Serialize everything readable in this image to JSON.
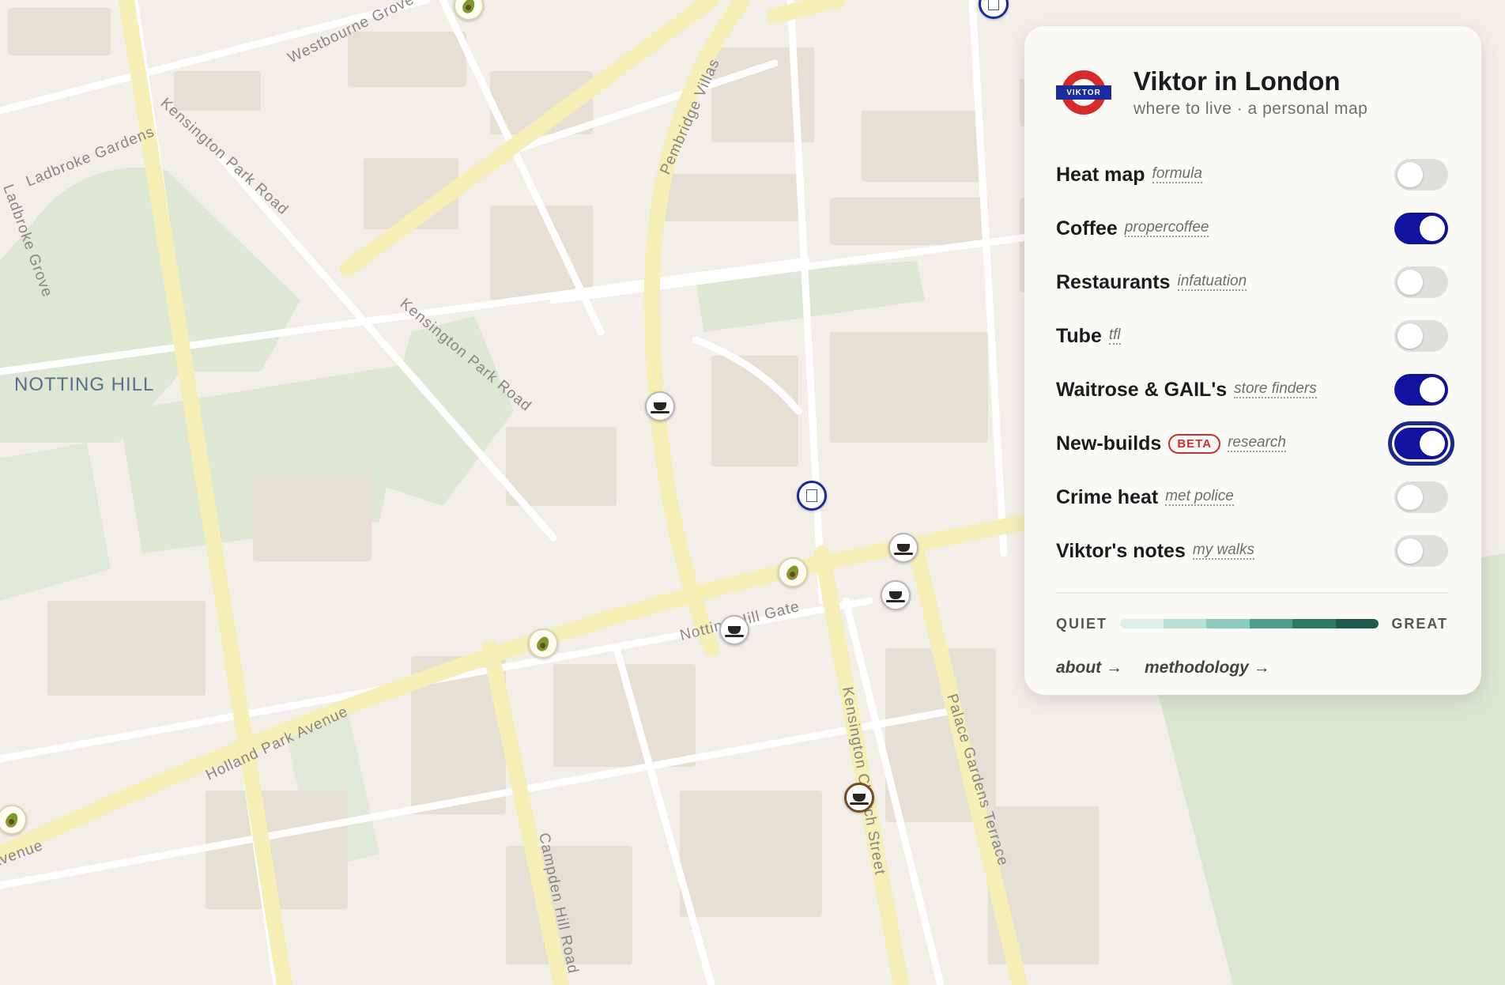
{
  "map": {
    "area_label": "NOTTING HILL",
    "streets": [
      "Westbourne Grove",
      "Ladbroke Gardens",
      "Kensington Park Road",
      "Kensington Park Road",
      "Pembridge Villas",
      "Notting Hill Gate",
      "Holland Park Avenue",
      "Campden Hill Road",
      "Kensington Church Street",
      "Palace Gardens Terrace",
      "Ladbroke Grove",
      "Avenue"
    ],
    "markers": [
      {
        "kind": "waitrose",
        "icon": "avocado-icon"
      },
      {
        "kind": "newbuild",
        "icon": "building-icon"
      },
      {
        "kind": "coffee",
        "icon": "coffee-cup-icon"
      },
      {
        "kind": "newbuild",
        "icon": "building-icon"
      },
      {
        "kind": "coffee",
        "icon": "coffee-cup-icon"
      },
      {
        "kind": "waitrose",
        "icon": "avocado-icon"
      },
      {
        "kind": "coffee",
        "icon": "coffee-cup-icon"
      },
      {
        "kind": "coffee",
        "icon": "coffee-cup-icon"
      },
      {
        "kind": "waitrose",
        "icon": "avocado-icon"
      },
      {
        "kind": "coffee",
        "icon": "coffee-cup-icon",
        "favourite": true
      },
      {
        "kind": "waitrose",
        "icon": "avocado-icon"
      }
    ]
  },
  "panel": {
    "roundel_text": "VIKTOR",
    "title": "Viktor in London",
    "subtitle": "where to live · a personal map",
    "layers": [
      {
        "name": "Heat map",
        "source": "formula",
        "on": false
      },
      {
        "name": "Coffee",
        "source": "propercoffee",
        "on": true
      },
      {
        "name": "Restaurants",
        "source": "infatuation",
        "on": false
      },
      {
        "name": "Tube",
        "source": "tfl",
        "on": false
      },
      {
        "name": "Waitrose & GAIL's",
        "source": "store finders",
        "on": true
      },
      {
        "name": "New-builds",
        "badge": "BETA",
        "source": "research",
        "on": true,
        "focused": true
      },
      {
        "name": "Crime heat",
        "source": "met police",
        "on": false
      },
      {
        "name": "Viktor's notes",
        "source": "my walks",
        "on": false
      }
    ],
    "legend": {
      "low": "QUIET",
      "high": "GREAT",
      "colors": [
        "#dcefe9",
        "#b7dfd6",
        "#8ccabe",
        "#4f9e8c",
        "#2e7a6a",
        "#1f5a4e"
      ]
    },
    "links": {
      "about": "about →",
      "methodology": "methodology →"
    },
    "colors": {
      "toggle_on": "#1212a0",
      "toggle_off": "#e0dedb",
      "beta": "#c8312c",
      "roundel_red": "#d52b2b",
      "roundel_blue": "#1b2a9c"
    }
  }
}
